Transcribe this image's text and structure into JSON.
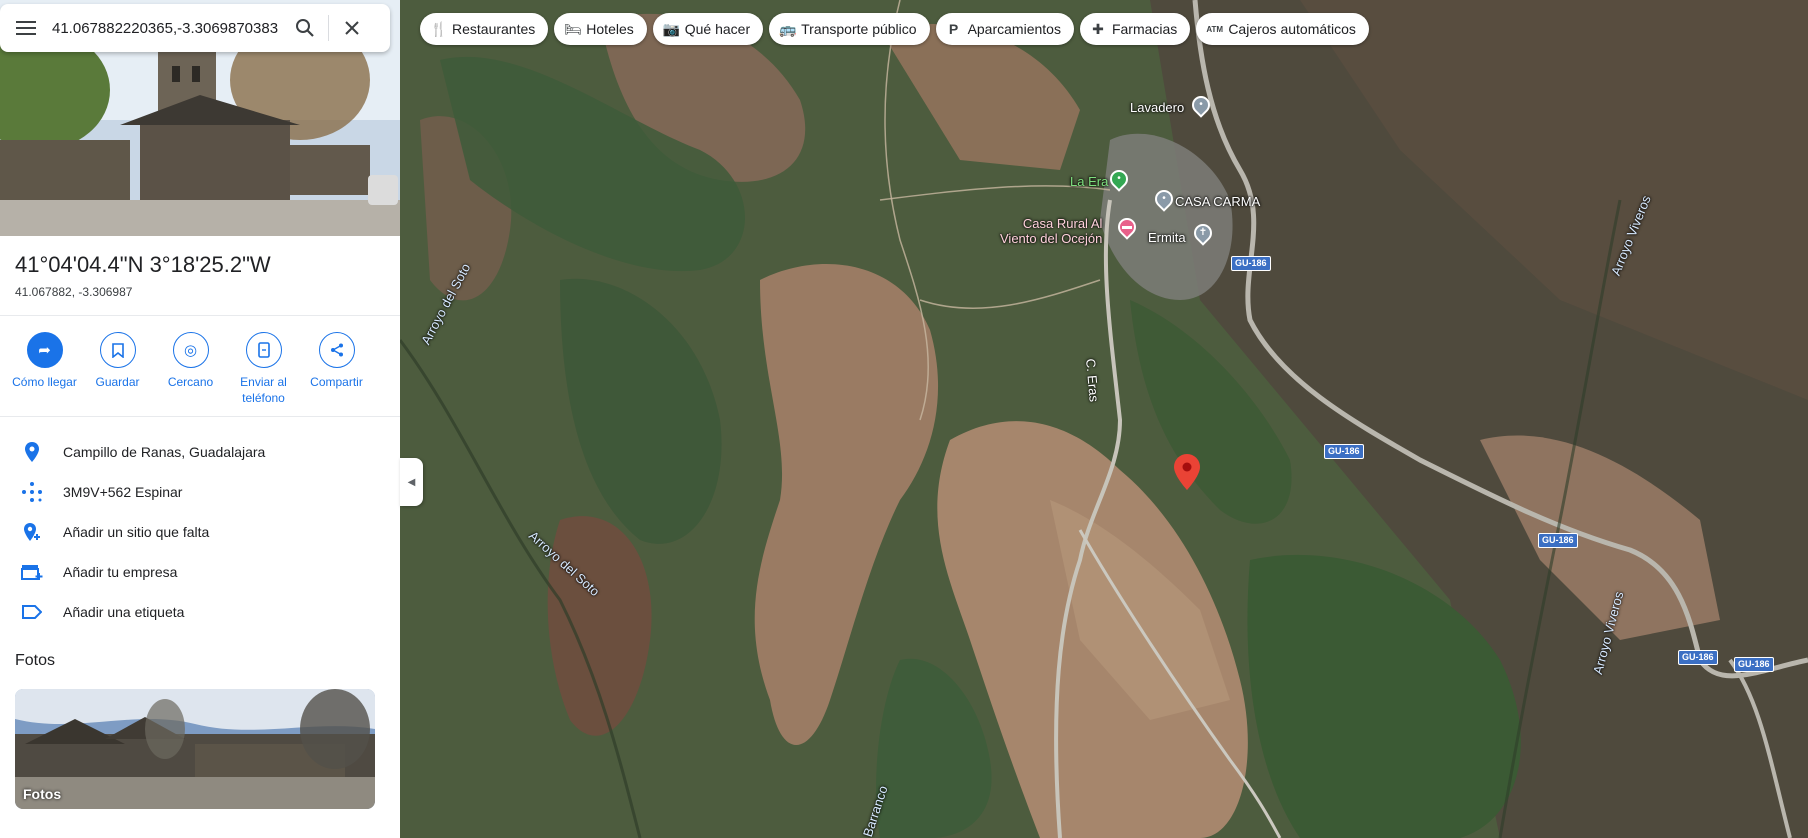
{
  "search": {
    "value": "41.067882220365,-3.3069870383"
  },
  "place": {
    "title": "41°04'04.4\"N 3°18'25.2\"W",
    "subtitle": "41.067882, -3.306987"
  },
  "actions": [
    {
      "label": "Cómo llegar"
    },
    {
      "label": "Guardar"
    },
    {
      "label": "Cercano"
    },
    {
      "label": "Enviar al teléfono"
    },
    {
      "label": "Compartir"
    }
  ],
  "info": [
    {
      "text": "Campillo de Ranas, Guadalajara",
      "icon": "location-pin-icon"
    },
    {
      "text": "3M9V+562 Espinar",
      "icon": "plus-code-icon"
    },
    {
      "text": "Añadir un sitio que falta",
      "icon": "add-place-icon"
    },
    {
      "text": "Añadir tu empresa",
      "icon": "add-business-icon"
    },
    {
      "text": "Añadir una etiqueta",
      "icon": "label-icon"
    }
  ],
  "photos": {
    "heading": "Fotos",
    "card_label": "Fotos"
  },
  "chips": [
    {
      "label": "Restaurantes",
      "icon": "fork-knife-icon"
    },
    {
      "label": "Hoteles",
      "icon": "bed-icon"
    },
    {
      "label": "Qué hacer",
      "icon": "camera-icon"
    },
    {
      "label": "Transporte público",
      "icon": "bus-icon"
    },
    {
      "label": "Aparcamientos",
      "icon": "parking-icon"
    },
    {
      "label": "Farmacias",
      "icon": "pharmacy-icon"
    },
    {
      "label": "Cajeros automáticos",
      "icon": "atm-icon"
    }
  ],
  "map": {
    "labels": {
      "lavadero": "Lavadero",
      "la_era": "La Era",
      "casa_carma": "CASA CARMA",
      "casa_rural": "Casa Rural Al\nViento del Ocejón",
      "ermita": "Ermita",
      "c_eras": "C. Eras",
      "arroyo_del_soto_1": "Arroyo del Soto",
      "arroyo_del_soto_2": "Arroyo del Soto",
      "arroyo_viveros_1": "Arroyo Viveros",
      "arroyo_viveros_2": "Arroyo Viveros",
      "barranco": "Barranco"
    },
    "road_shields": [
      "GU-186",
      "GU-186",
      "GU-186",
      "GU-186",
      "GU-186"
    ],
    "colors": {
      "accent": "#1a73e8",
      "pin": "#ea4335",
      "shield": "#3b6fc4"
    }
  }
}
